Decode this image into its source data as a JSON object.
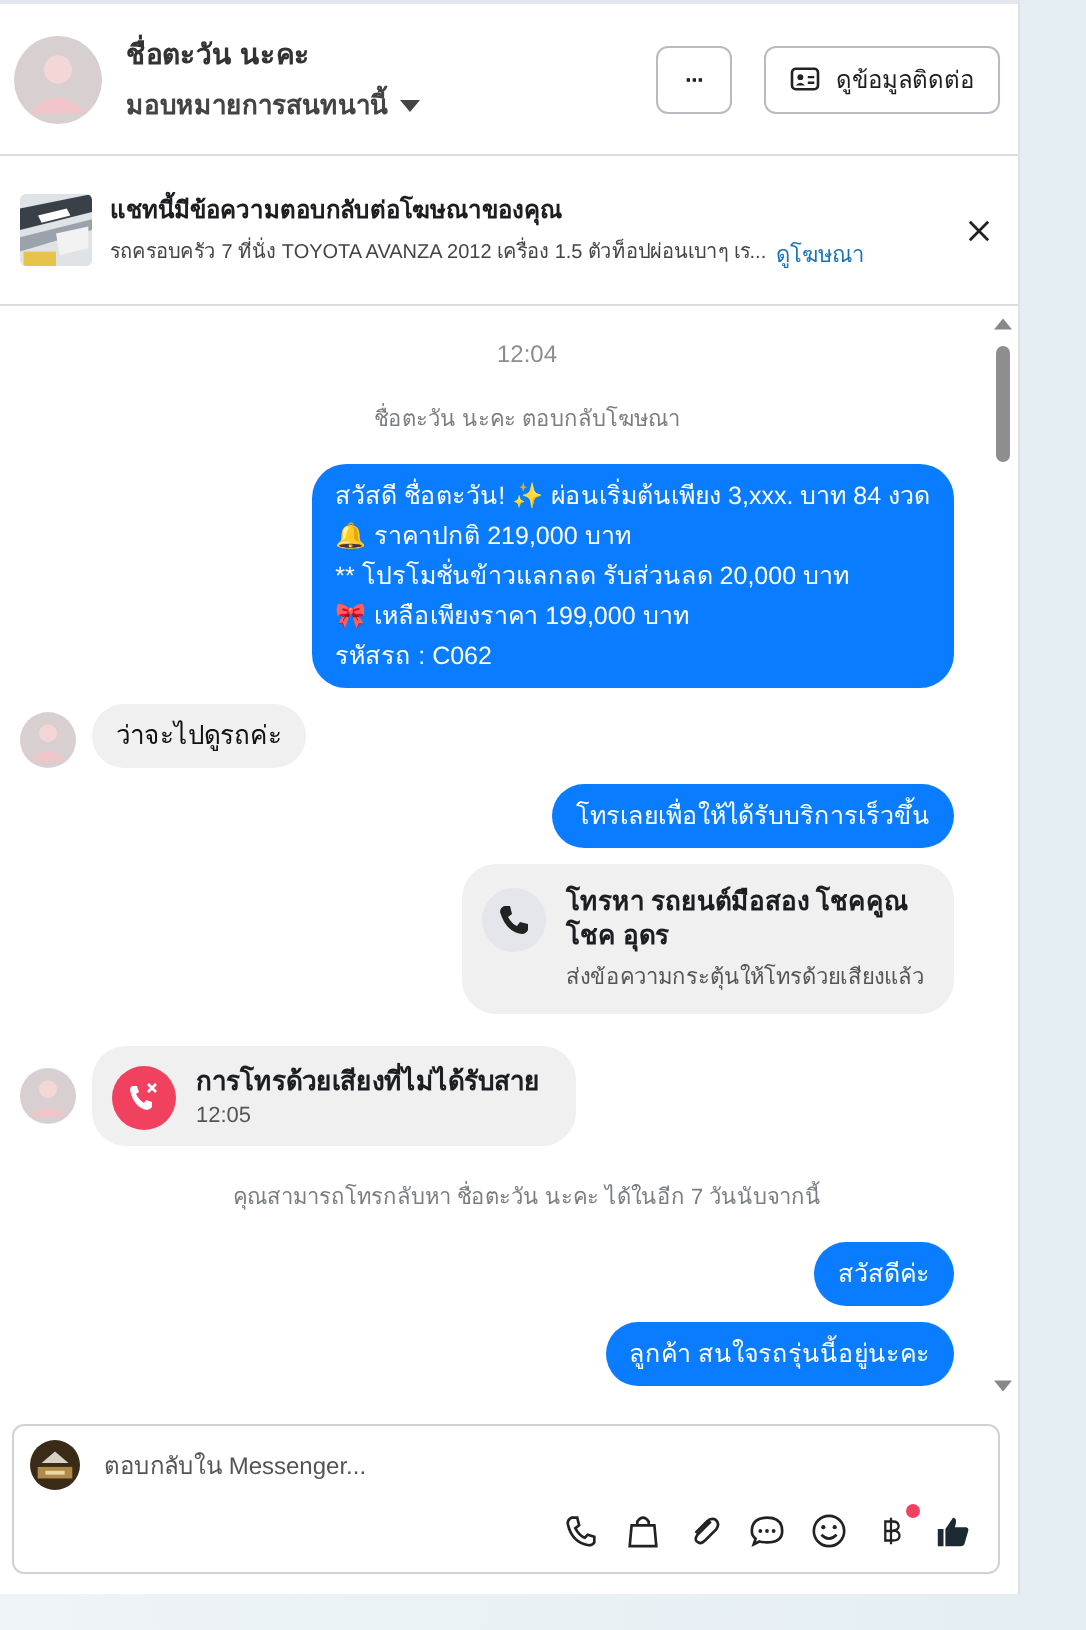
{
  "header": {
    "name": "ชื่อตะวัน นะคะ",
    "assign": "มอบหมายการสนทนานี้",
    "more_button": "···",
    "contact_button": "ดูข้อมูลติดต่อ"
  },
  "ad_banner": {
    "title": "แชทนี้มีข้อความตอบกลับต่อโฆษณาของคุณ",
    "text": "รถครอบครัว 7 ที่นั่ง TOYOTA AVANZA 2012 เครื่อง 1.5 ตัวท็อปผ่อนเบาๆ เร...",
    "link": "ดูโฆษณา"
  },
  "messages": [
    {
      "kind": "time",
      "text": "12:04"
    },
    {
      "kind": "note",
      "text": "ชื่อตะวัน นะคะ ตอบกลับโฆษณา"
    },
    {
      "kind": "out",
      "text": "สวัสดี ชื่อตะวัน! ✨  ผ่อนเริ่มต้นเพียง 3,xxx. บาท 84 งวด\n🔔 ราคาปกติ 219,000 บาท\n** โปรโมชั่นข้าวแลกลด รับส่วนลด 20,000 บาท\n🎀  เหลือเพียงราคา 199,000 บาท\n รหัสรถ : C062"
    },
    {
      "kind": "in",
      "text": "ว่าจะไปดูรถค่ะ"
    },
    {
      "kind": "out",
      "text": "โทรเลยเพื่อให้ได้รับบริการเร็วขึ้น"
    },
    {
      "kind": "call_card",
      "title": "โทรหา รถยนต์มือสอง โชคคูณ โชค อุดร",
      "text": "ส่งข้อความกระตุ้นให้โทรด้วยเสียงแล้ว"
    },
    {
      "kind": "missed_call",
      "title": "การโทรด้วยเสียงที่ไม่ได้รับสาย",
      "text": "12:05"
    },
    {
      "kind": "note",
      "text": "คุณสามารถโทรกลับหา ชื่อตะวัน นะคะ ได้ในอีก 7 วันนับจากนี้"
    },
    {
      "kind": "out",
      "text": "สวัสดีค่ะ"
    },
    {
      "kind": "out",
      "text": "ลูกค้า สนใจรถรุ่นนี้อยู่นะคะ"
    }
  ],
  "composer": {
    "placeholder": "ตอบกลับใน Messenger...",
    "tools": [
      {
        "kind": "phone",
        "badge": false
      },
      {
        "kind": "bag",
        "badge": false
      },
      {
        "kind": "clip",
        "badge": false
      },
      {
        "kind": "chat",
        "badge": false
      },
      {
        "kind": "smile",
        "badge": false
      },
      {
        "kind": "baht",
        "badge": true
      },
      {
        "kind": "like",
        "badge": false
      }
    ]
  }
}
